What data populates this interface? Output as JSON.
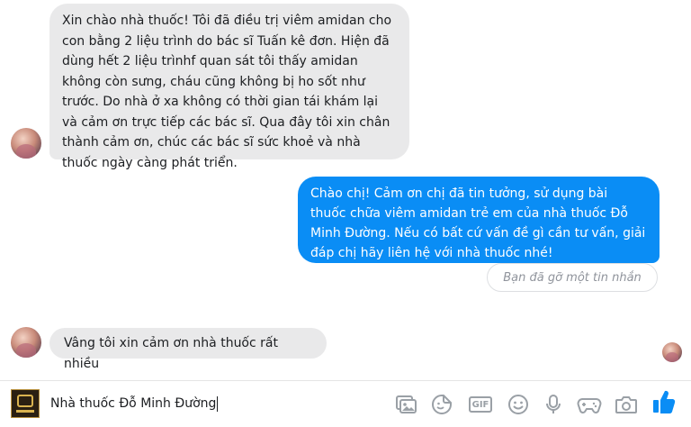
{
  "conversation": {
    "messages": [
      {
        "sender": "customer",
        "text": "Xin chào nhà thuốc! Tôi đã điều trị viêm amidan cho con bằng 2 liệu trình do bác sĩ Tuấn kê đơn. Hiện đã dùng hết 2 liệu trìnhf quan sát tôi thấy amidan không còn sưng, cháu cũng không bị ho sốt như trước. Do nhà ở xa không có thời gian tái khám lại và cảm ơn trực tiếp các bác sĩ. Qua đây tôi xin chân thành cảm ơn, chúc các bác sĩ sức khoẻ và nhà thuốc ngày càng phát triển."
      },
      {
        "sender": "pharmacy",
        "text": "Chào chị! Cảm ơn chị đã tin tưởng, sử dụng bài thuốc chữa viêm amidan trẻ em của nhà thuốc Đỗ Minh Đường. Nếu có bất cứ vấn đề gì cần tư vấn, giải đáp chị hãy liên hệ với nhà thuốc nhé!"
      },
      {
        "sender": "customer",
        "text": "Vâng tôi xin cảm ơn nhà thuốc rất nhiều"
      }
    ],
    "removed_notice": "Bạn đã gỡ một tin nhắn"
  },
  "composer": {
    "page_name": "Nhà thuốc Đỗ Minh Đường",
    "icons": [
      "photo-icon",
      "sticker-icon",
      "gif-icon",
      "emoji-icon",
      "microphone-icon",
      "game-icon",
      "camera-icon",
      "like-icon"
    ],
    "gif_label": "GIF"
  },
  "colors": {
    "outgoing_bubble": "#0a8df5",
    "incoming_bubble": "#e9e9ea",
    "like_button": "#0a8df5",
    "icon_gray": "#9aa0a6"
  }
}
